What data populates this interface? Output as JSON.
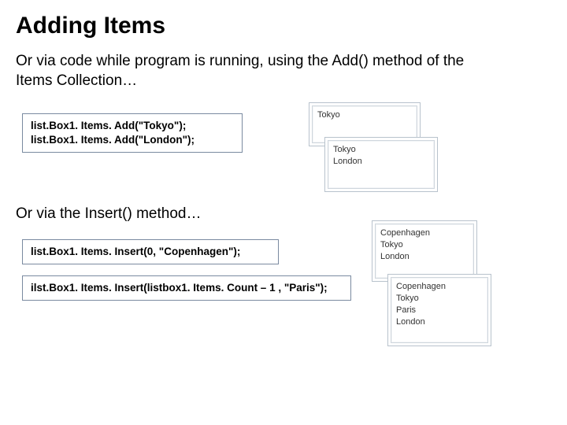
{
  "title": "Adding Items",
  "para1": "Or via code while program is running, using the Add() method of the Items Collection…",
  "para2": "Or via the Insert() method…",
  "code1": {
    "line1": "list.Box1. Items. Add(\"Tokyo\");",
    "line2": "list.Box1. Items. Add(\"London\");"
  },
  "code2": {
    "line1": "list.Box1. Items. Insert(0, \"Copenhagen\");"
  },
  "code3": {
    "line1": "ilst.Box1. Items. Insert(listbox1. Items. Count – 1 , \"Paris\");"
  },
  "listbox1": {
    "items": [
      "Tokyo"
    ]
  },
  "listbox2": {
    "items": [
      "Tokyo",
      "London"
    ]
  },
  "listbox3": {
    "items": [
      "Copenhagen",
      "Tokyo",
      "London"
    ]
  },
  "listbox4": {
    "items": [
      "Copenhagen",
      "Tokyo",
      "Paris",
      "London"
    ]
  }
}
